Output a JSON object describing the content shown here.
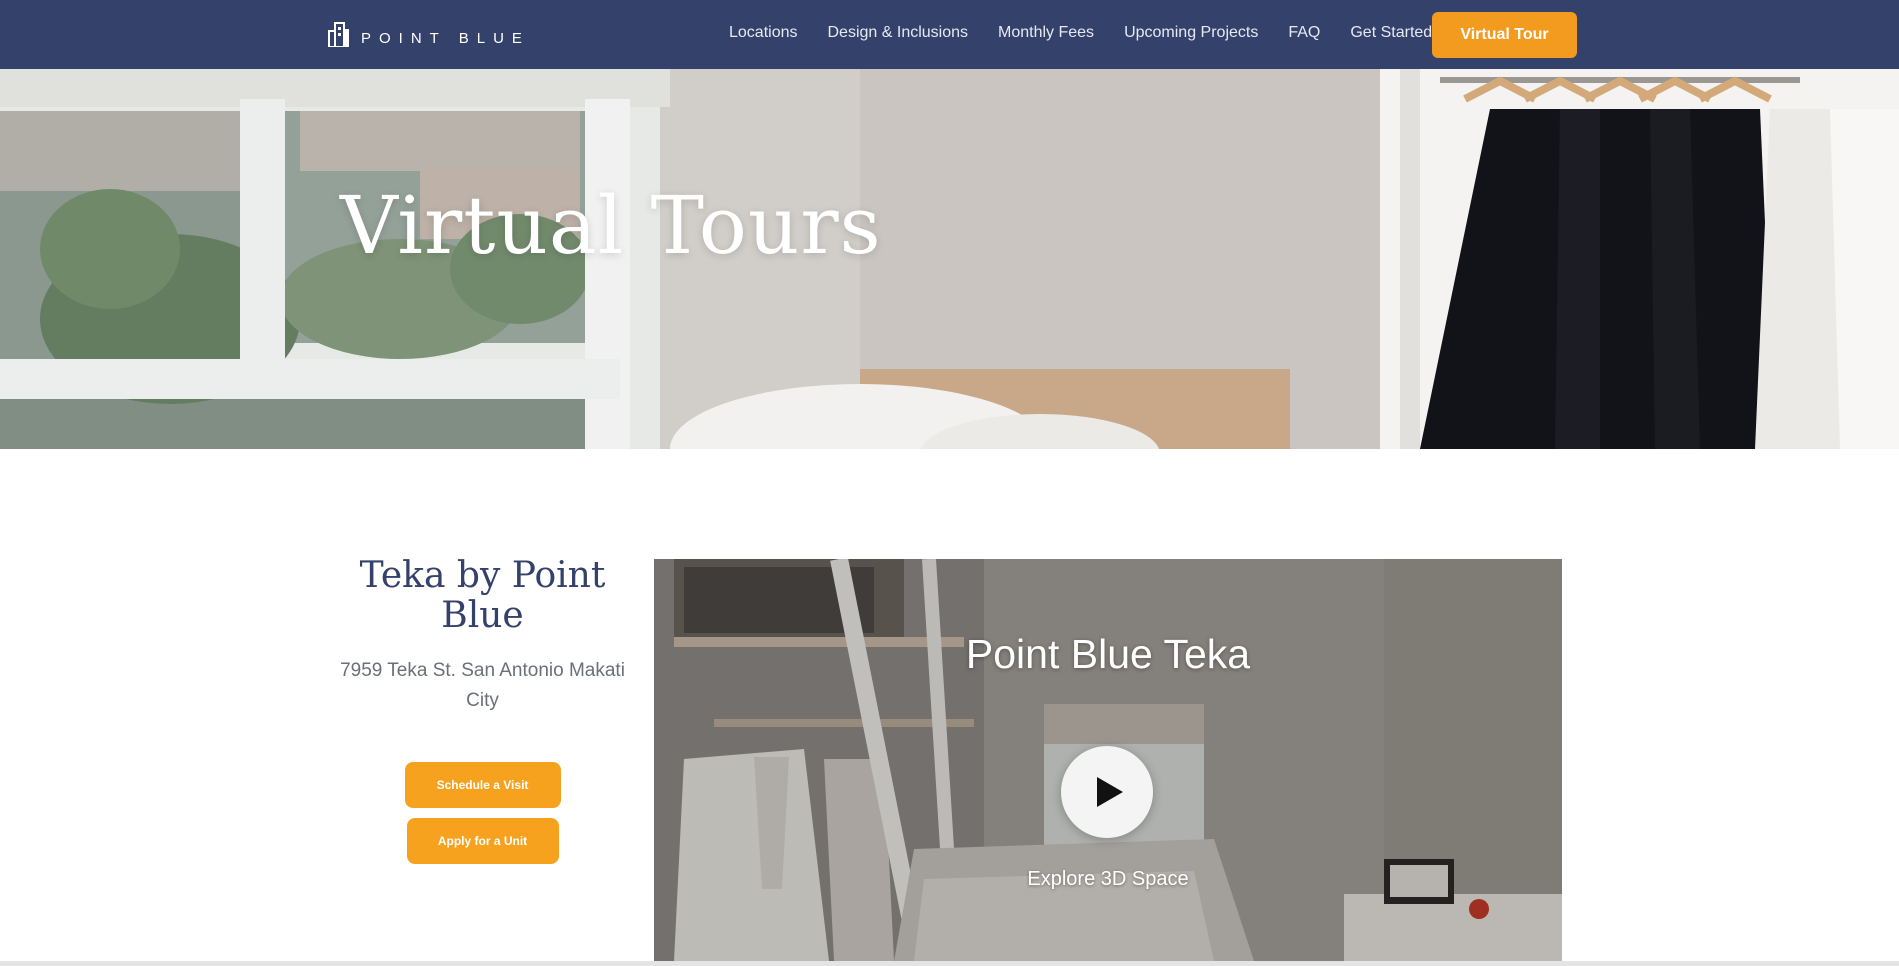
{
  "brand": {
    "name": "POINT BLUE",
    "accent": "#f29b1f",
    "nav_bg": "#34426b",
    "title_color": "#34426b"
  },
  "nav": {
    "links": [
      "Locations",
      "Design & Inclusions",
      "Monthly Fees",
      "Upcoming Projects",
      "FAQ",
      "Get Started"
    ],
    "cta_label": "Virtual Tour"
  },
  "hero": {
    "title": "Virtual Tours"
  },
  "property": {
    "title": "Teka by Point Blue",
    "address": "7959 Teka St. San Antonio Makati City",
    "schedule_label": "Schedule a Visit",
    "apply_label": "Apply for a Unit"
  },
  "tour": {
    "title": "Point Blue Teka",
    "caption": "Explore 3D Space",
    "play_icon": "play-icon"
  }
}
